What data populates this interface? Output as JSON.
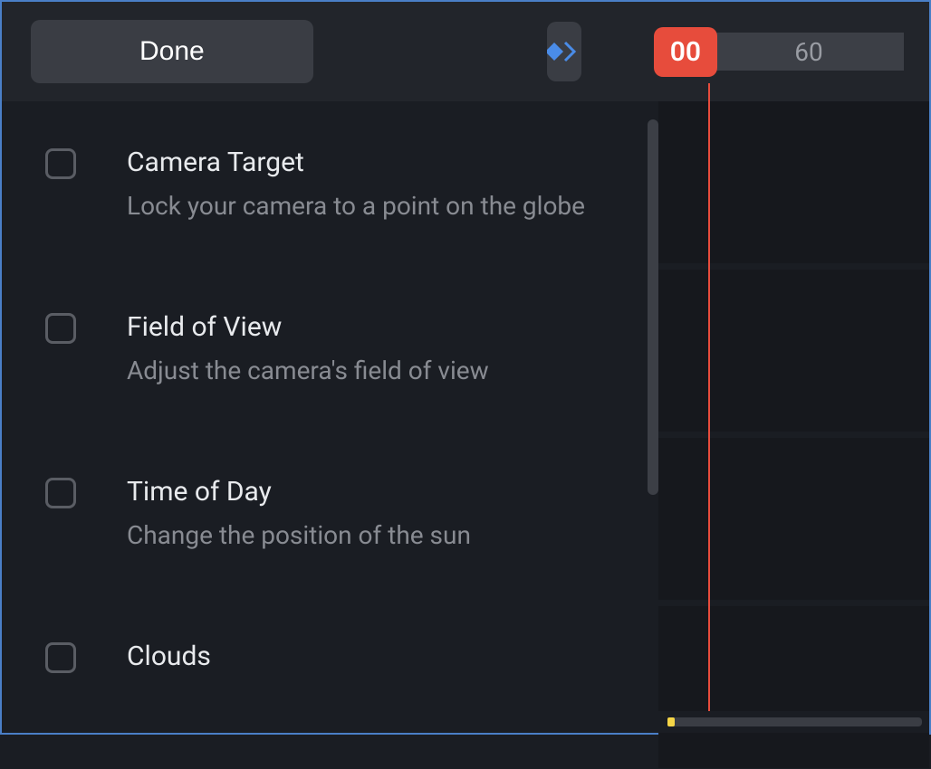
{
  "header": {
    "done_label": "Done",
    "current_time": "00",
    "ruler_tick": "60"
  },
  "settings": [
    {
      "title": "Camera Target",
      "description": "Lock your camera to a point on the globe"
    },
    {
      "title": "Field of View",
      "description": "Adjust the camera's field of view"
    },
    {
      "title": "Time of Day",
      "description": "Change the position of the sun"
    },
    {
      "title": "Clouds",
      "description": ""
    }
  ],
  "colors": {
    "accent_red": "#e74c3c",
    "accent_blue": "#4a7fc7",
    "accent_yellow": "#f5d547"
  }
}
